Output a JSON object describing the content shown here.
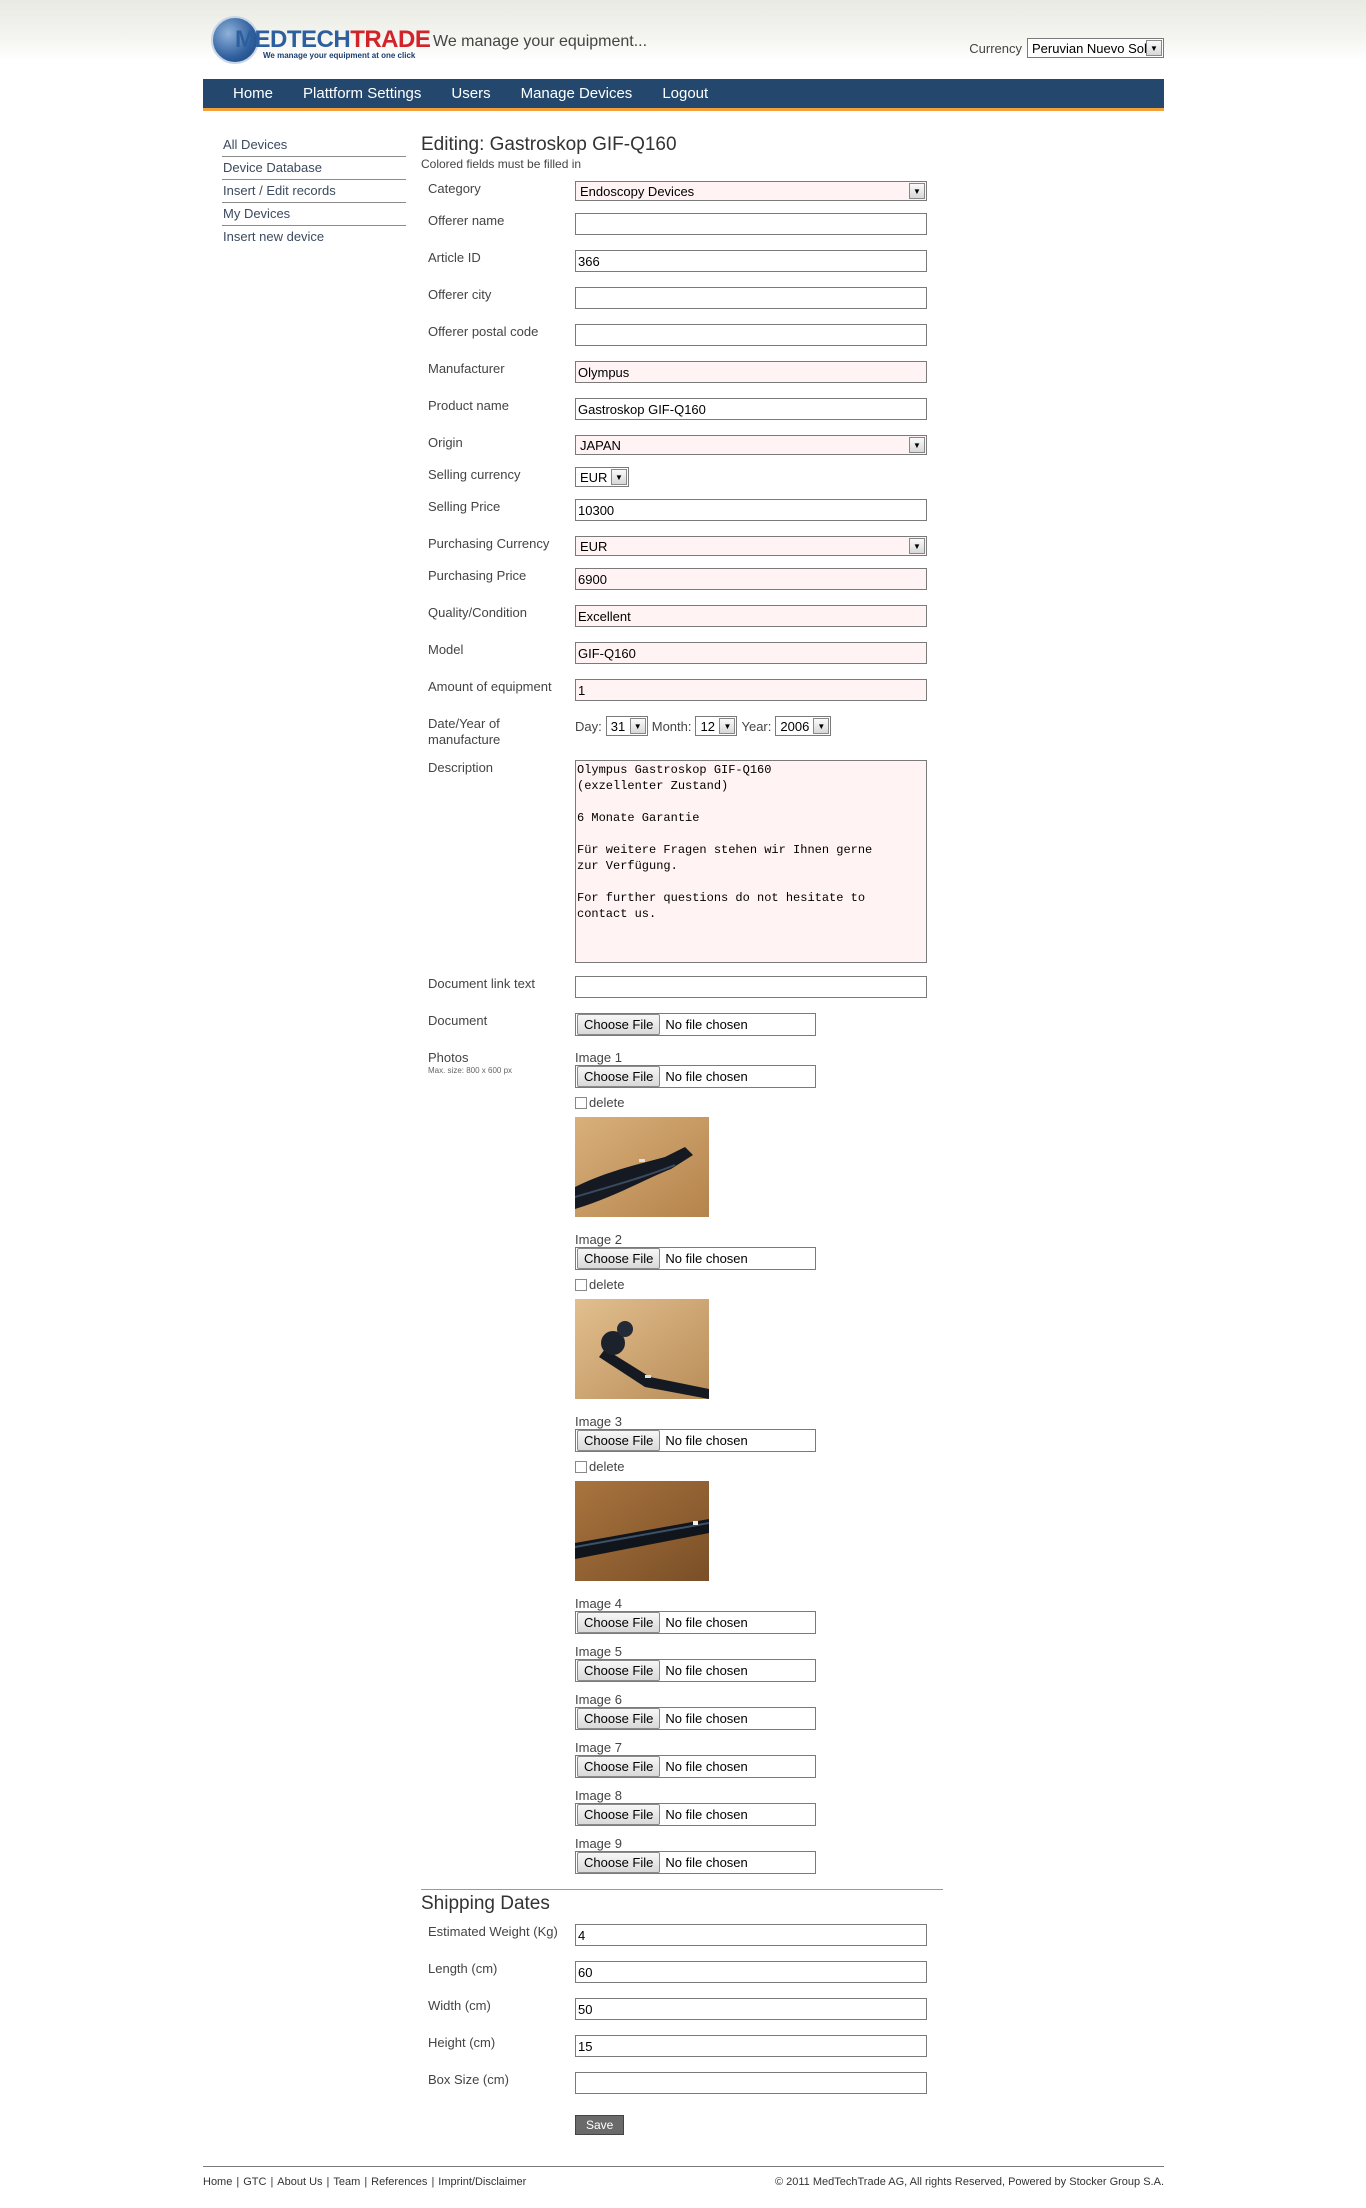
{
  "header": {
    "logo_text_med": "MED",
    "logo_text_tech": "TECH",
    "logo_text_trade": "TRADE",
    "logo_sub": "We manage your equipment at one click",
    "tagline": "We manage your equipment...",
    "currency_label": "Currency",
    "currency_value": "Peruvian Nuevo Sol"
  },
  "nav": [
    "Home",
    "Plattform Settings",
    "Users",
    "Manage Devices",
    "Logout"
  ],
  "sidebar": [
    "All Devices",
    "Device Database",
    "Insert / Edit records",
    "My Devices",
    "Insert new device"
  ],
  "form": {
    "title": "Editing: Gastroskop GIF-Q160",
    "note": "Colored fields must be filled in",
    "category_label": "Category",
    "category_value": "Endoscopy Devices",
    "offerer_name_label": "Offerer name",
    "offerer_name_value": "",
    "article_id_label": "Article ID",
    "article_id_value": "366",
    "offerer_city_label": "Offerer city",
    "offerer_city_value": "",
    "offerer_postal_label": "Offerer postal code",
    "offerer_postal_value": "",
    "manufacturer_label": "Manufacturer",
    "manufacturer_value": "Olympus",
    "product_name_label": "Product name",
    "product_name_value": "Gastroskop GIF-Q160",
    "origin_label": "Origin",
    "origin_value": "JAPAN",
    "selling_currency_label": "Selling currency",
    "selling_currency_value": "EUR",
    "selling_price_label": "Selling Price",
    "selling_price_value": "10300",
    "purchasing_currency_label": "Purchasing Currency",
    "purchasing_currency_value": "EUR",
    "purchasing_price_label": "Purchasing Price",
    "purchasing_price_value": "6900",
    "quality_label": "Quality/Condition",
    "quality_value": "Excellent",
    "model_label": "Model",
    "model_value": "GIF-Q160",
    "amount_label": "Amount of equipment",
    "amount_value": "1",
    "date_label": "Date/Year of manufacture",
    "day_label": "Day:",
    "day_value": "31",
    "month_label": "Month:",
    "month_value": "12",
    "year_label": "Year:",
    "year_value": "2006",
    "description_label": "Description",
    "description_value": "Olympus Gastroskop GIF-Q160\n(exzellenter Zustand)\n\n6 Monate Garantie\n\nFür weitere Fragen stehen wir Ihnen gerne\nzur Verfügung.\n\nFor further questions do not hesitate to\ncontact us.",
    "doc_link_label": "Document link text",
    "doc_link_value": "",
    "document_label": "Document",
    "photos_label": "Photos",
    "photos_hint": "Max. size: 800 x 600 px",
    "choose_file": "Choose File",
    "no_file": "No file chosen",
    "delete_label": "delete",
    "images": [
      "Image 1",
      "Image 2",
      "Image 3",
      "Image 4",
      "Image 5",
      "Image 6",
      "Image 7",
      "Image 8",
      "Image 9"
    ]
  },
  "shipping": {
    "title": "Shipping Dates",
    "weight_label": "Estimated Weight (Kg)",
    "weight_value": "4",
    "length_label": "Length (cm)",
    "length_value": "60",
    "width_label": "Width (cm)",
    "width_value": "50",
    "height_label": "Height (cm)",
    "height_value": "15",
    "box_label": "Box Size (cm)",
    "box_value": "",
    "save_label": "Save"
  },
  "footer": {
    "links": [
      "Home",
      "GTC",
      "About Us",
      "Team",
      "References",
      "Imprint/Disclaimer"
    ],
    "copyright": "© 2011 MedTechTrade AG, All rights Reserved, Powered by Stocker Group S.A."
  },
  "colors": {
    "nav_bg": "#23476d",
    "nav_accent": "#f3a03b",
    "required_field_bg": "#fff3f3",
    "logo_blue": "#2d5f9f",
    "logo_red": "#d2232a"
  }
}
